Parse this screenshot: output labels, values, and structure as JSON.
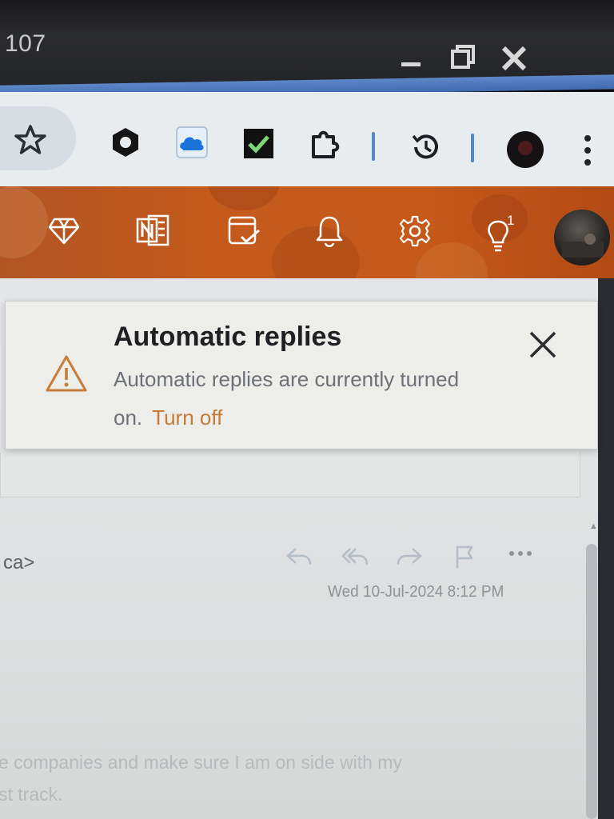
{
  "titlebar": {
    "tab_fragment": "107",
    "minimize": "minimize",
    "restore": "restore",
    "close": "close"
  },
  "toolbar": {
    "icons": [
      "star-icon",
      "camera-extension-icon",
      "onedrive-cloud-icon",
      "todo-check-icon",
      "extensions-puzzle-icon",
      "history-icon",
      "profile-icon",
      "menu-dots-icon"
    ]
  },
  "outlook_header": {
    "icons": [
      "premium-diamond-icon",
      "onenote-icon",
      "calendar-check-icon",
      "bell-icon",
      "settings-gear-icon",
      "tips-lightbulb-icon"
    ],
    "tips_badge": "1"
  },
  "banner": {
    "title": "Automatic replies",
    "message": "Automatic replies are currently turned on.",
    "action": "Turn off"
  },
  "message": {
    "sender_fragment": "ca>",
    "date": "Wed 10-Jul-2024 8:12 PM",
    "body_line_1": "e companies and make sure I am on side with my",
    "body_line_2": "st track."
  },
  "colors": {
    "header_orange": "#c45a1c",
    "turn_off_link": "#c77b36",
    "warning_icon": "#c97b37",
    "accent_blue": "#4f8ad1"
  }
}
